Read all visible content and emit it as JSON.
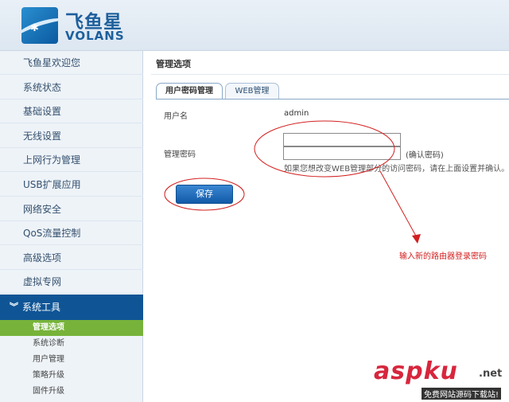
{
  "brand": {
    "name_cn": "飞鱼星",
    "name_en": "VOLANS"
  },
  "sidebar": {
    "items": [
      {
        "label": "飞鱼星欢迎您"
      },
      {
        "label": "系统状态"
      },
      {
        "label": "基础设置"
      },
      {
        "label": "无线设置"
      },
      {
        "label": "上网行为管理"
      },
      {
        "label": "USB扩展应用"
      },
      {
        "label": "网络安全"
      },
      {
        "label": "QoS流量控制"
      },
      {
        "label": "高级选项"
      },
      {
        "label": "虚拟专网"
      }
    ],
    "section": {
      "label": "系统工具",
      "icon": "double-chevron-down-icon"
    },
    "sub_items": [
      {
        "label": "管理选项",
        "active": true
      },
      {
        "label": "系统诊断"
      },
      {
        "label": "用户管理"
      },
      {
        "label": "策略升级"
      },
      {
        "label": "固件升级"
      }
    ]
  },
  "main": {
    "title": "管理选项",
    "tabs": [
      {
        "label": "用户密码管理",
        "active": true
      },
      {
        "label": "WEB管理"
      }
    ],
    "form": {
      "username_label": "用户名",
      "username_value": "admin",
      "password_label": "管理密码",
      "password_value": "",
      "confirm_value": "",
      "confirm_label": "(确认密码)",
      "hint": "如果您想改变WEB管理部分的访问密码，请在上面设置并确认。"
    },
    "save_label": "保存"
  },
  "annotation": {
    "text": "输入新的路由器登录密码",
    "color": "#d22020"
  },
  "watermark": {
    "main": "aspku",
    "tld": ".net",
    "sub": "免费网站源码下载站!"
  }
}
